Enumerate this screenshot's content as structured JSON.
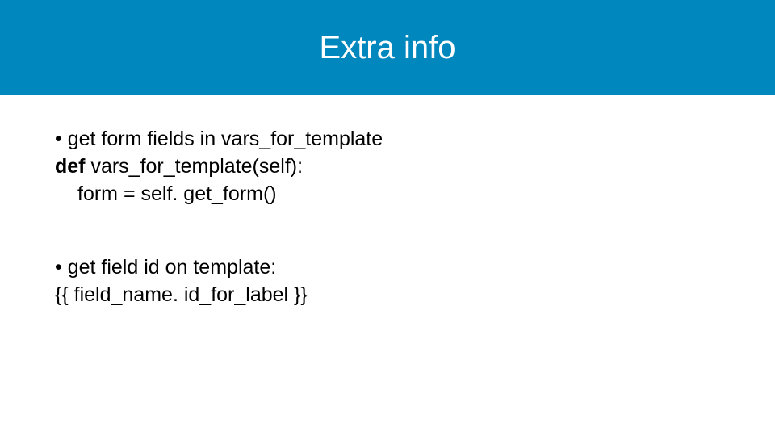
{
  "header": {
    "title": "Extra info"
  },
  "section1": {
    "bullet": "• get form fields in vars_for_template",
    "def_keyword": "def",
    "def_rest": " vars_for_template(self):",
    "code_line": "form = self. get_form()"
  },
  "section2": {
    "bullet": "• get field id on template:",
    "template_line": "{{ field_name. id_for_label }}"
  }
}
